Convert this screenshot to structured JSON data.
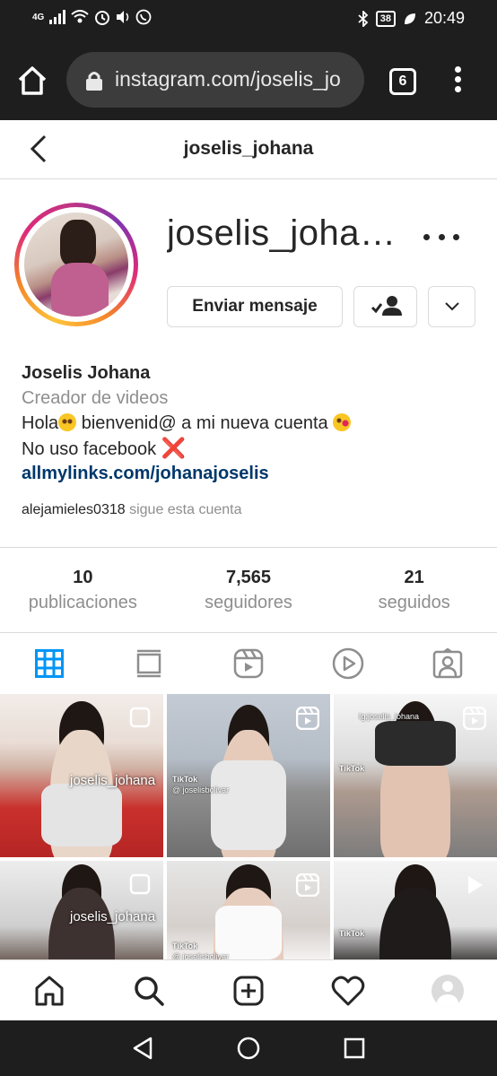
{
  "status_bar": {
    "network": "4G",
    "battery": "38",
    "time": "20:49"
  },
  "browser": {
    "url": "instagram.com/joselis_jo",
    "tab_count": "6"
  },
  "header": {
    "title": "joselis_johana"
  },
  "profile": {
    "username": "joselis_johana",
    "message_button": "Enviar mensaje"
  },
  "bio": {
    "name": "Joselis Johana",
    "category": "Creador de videos",
    "line1_a": "Hola",
    "line1_b": " bienvenid@ a mi nueva cuenta ",
    "line2_a": "No uso facebook ",
    "cross": "❌",
    "link": "allmylinks.com/johanajoselis"
  },
  "followed_by": {
    "name": "alejamieles0318",
    "text": " sigue esta cuenta"
  },
  "stats": [
    {
      "num": "10",
      "label": "publicaciones"
    },
    {
      "num": "7,565",
      "label": "seguidores"
    },
    {
      "num": "21",
      "label": "seguidos"
    }
  ],
  "grid": {
    "cell1_watermark": "joselis_johana",
    "cell3_watermark": "Ig:joselis_johana",
    "cell4_watermark": "joselis_johana",
    "tiktok": "TikTok",
    "tiktok_handle": "@ joselisbolivar"
  },
  "colors": {
    "link": "#00376b",
    "tab_active": "#0095f6",
    "muted": "#8e8e8e"
  }
}
